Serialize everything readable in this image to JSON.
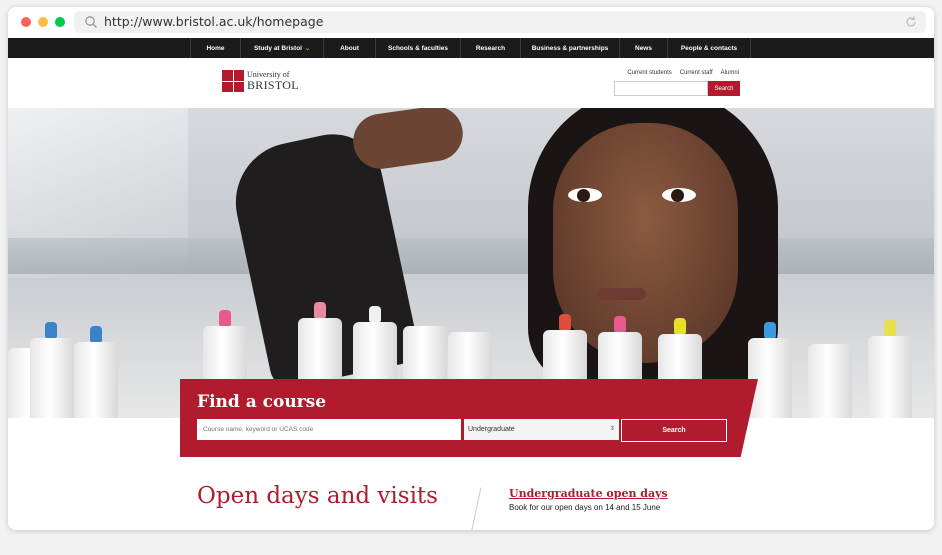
{
  "browser": {
    "url": "http://www.bristol.ac.uk/homepage"
  },
  "topnav": [
    {
      "label": "Home",
      "w": 50
    },
    {
      "label": "Study at Bristol",
      "w": 83,
      "chevron": "⌄"
    },
    {
      "label": "About",
      "w": 52
    },
    {
      "label": "Schools & faculties",
      "w": 85
    },
    {
      "label": "Research",
      "w": 60
    },
    {
      "label": "Business & partnerships",
      "w": 99
    },
    {
      "label": "News",
      "w": 48
    },
    {
      "label": "People & contacts",
      "w": 84
    }
  ],
  "header": {
    "logo_line1": "University of",
    "logo_line2": "BRISTOL",
    "links": [
      "Current students",
      "Current staff",
      "Alumni"
    ],
    "search_label": "Search"
  },
  "find_course": {
    "title": "Find a course",
    "placeholder": "Course name, keyword or UCAS code",
    "level": "Undergraduate",
    "level_arrow": "⇕",
    "search_label": "Search"
  },
  "main": {
    "open_days_title": "Open days and visits",
    "ug_title": "Undergraduate open days",
    "ug_text": "Book for our open days on 14 and 15 June"
  },
  "colors": {
    "brand_red": "#b01c2e",
    "nav_bg": "#1b1b1b"
  },
  "icons": {
    "url_search": "search-icon",
    "reload": "reload-icon",
    "crest": "university-crest-icon"
  }
}
